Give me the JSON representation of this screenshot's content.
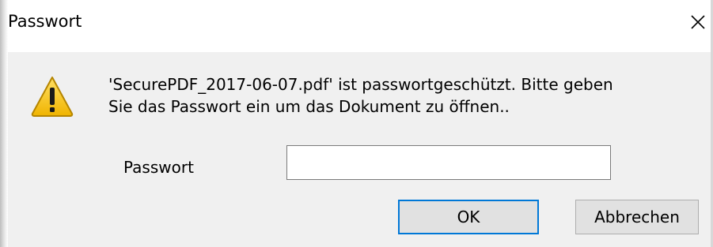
{
  "window": {
    "title": "Passwort"
  },
  "icons": {
    "close": "close-icon",
    "warning": "warning-icon"
  },
  "message": {
    "line1": "'SecurePDF_2017-06-07.pdf' ist passwortgeschützt. Bitte geben",
    "line2": "Sie das Passwort ein um das Dokument zu öffnen.."
  },
  "form": {
    "password_label": "Passwort",
    "password_value": "",
    "password_placeholder": ""
  },
  "buttons": {
    "ok_label": "OK",
    "cancel_label": "Abbrechen"
  },
  "colors": {
    "focus_border": "#0078d7",
    "warning_yellow": "#f5c400",
    "content_bg": "#f0f0f0"
  }
}
